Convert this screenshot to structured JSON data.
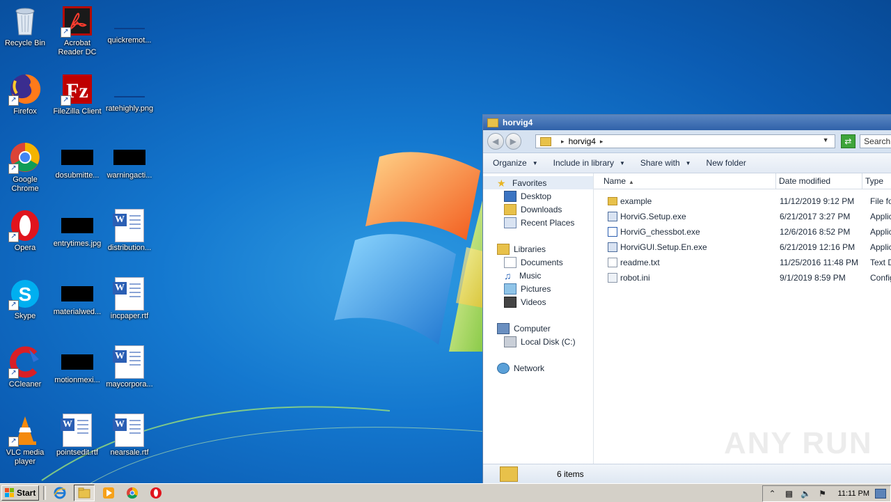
{
  "desktop": {
    "icons": [
      {
        "label": "Recycle Bin"
      },
      {
        "label": "Acrobat Reader DC"
      },
      {
        "label": "quickremot..."
      },
      {
        "label": "Firefox"
      },
      {
        "label": "FileZilla Client"
      },
      {
        "label": "ratehighly.png"
      },
      {
        "label": "Google Chrome"
      },
      {
        "label": "dosubmitte..."
      },
      {
        "label": "warningacti..."
      },
      {
        "label": "Opera"
      },
      {
        "label": "entrytimes.jpg"
      },
      {
        "label": "distribution..."
      },
      {
        "label": "Skype"
      },
      {
        "label": "materialwed..."
      },
      {
        "label": "incpaper.rtf"
      },
      {
        "label": "CCleaner"
      },
      {
        "label": "motionmexi..."
      },
      {
        "label": "maycorpora..."
      },
      {
        "label": "VLC media player"
      },
      {
        "label": "pointsedit.rtf"
      },
      {
        "label": "nearsale.rtf"
      }
    ]
  },
  "explorer": {
    "title": "horvig4",
    "address": {
      "crumb": "horvig4"
    },
    "search_placeholder": "Search",
    "commands": {
      "organize": "Organize",
      "include": "Include in library",
      "share": "Share with",
      "new_folder": "New folder"
    },
    "nav": {
      "favorites": "Favorites",
      "desktop": "Desktop",
      "downloads": "Downloads",
      "recent": "Recent Places",
      "libraries": "Libraries",
      "documents": "Documents",
      "music": "Music",
      "pictures": "Pictures",
      "videos": "Videos",
      "computer": "Computer",
      "local_disk": "Local Disk (C:)",
      "network": "Network"
    },
    "columns": {
      "name": "Name",
      "date": "Date modified",
      "type": "Type"
    },
    "files": [
      {
        "name": "example",
        "date": "11/12/2019 9:12 PM",
        "type": "File fo",
        "icon": "folder-icon"
      },
      {
        "name": "HorviG.Setup.exe",
        "date": "6/21/2017 3:27 PM",
        "type": "Applic",
        "icon": "installer-icon"
      },
      {
        "name": "HorviG_chessbot.exe",
        "date": "12/6/2016 8:52 PM",
        "type": "Applic",
        "icon": "application-icon"
      },
      {
        "name": "HorviGUI.Setup.En.exe",
        "date": "6/21/2019 12:16 PM",
        "type": "Applic",
        "icon": "installer-icon"
      },
      {
        "name": "readme.txt",
        "date": "11/25/2016 11:48 PM",
        "type": "Text D",
        "icon": "text-file-icon"
      },
      {
        "name": "robot.ini",
        "date": "9/1/2019 8:59 PM",
        "type": "Config",
        "icon": "settings-file-icon"
      }
    ],
    "status": "6 items"
  },
  "watermark": "ANY RUN",
  "taskbar": {
    "start_label": "Start",
    "clock": "11:11 PM",
    "apps": [
      "internet-explorer-icon",
      "file-explorer-icon",
      "media-player-icon",
      "chrome-icon",
      "opera-icon"
    ]
  },
  "colors": {
    "desktop_blue": "#1478cf",
    "titlebar": "#2f62a9",
    "taskbar": "#d4d0c8"
  }
}
